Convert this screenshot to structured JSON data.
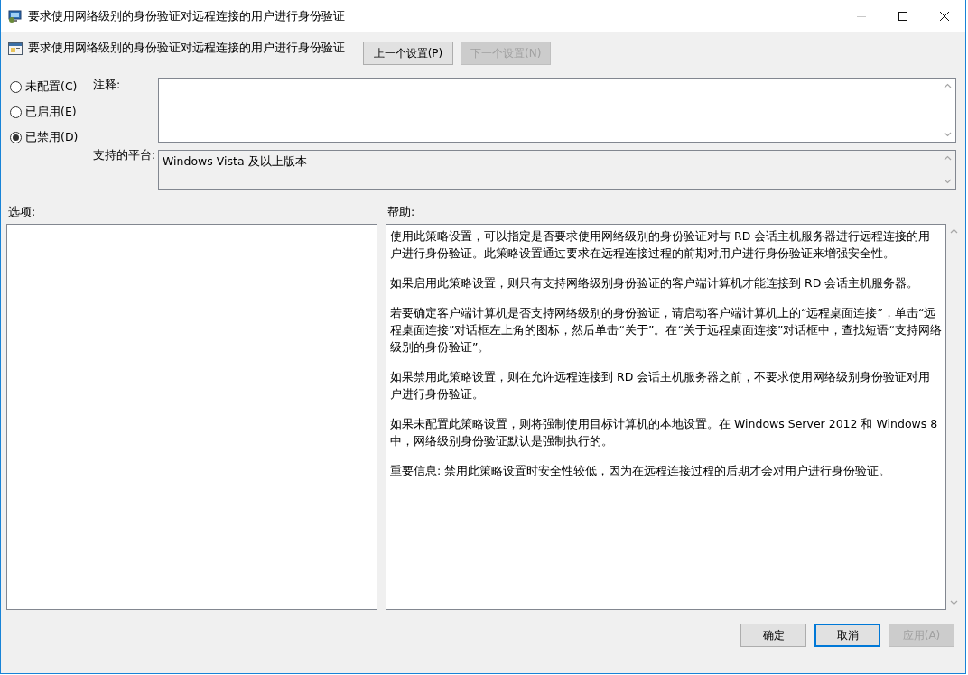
{
  "window": {
    "title": "要求使用网络级别的身份验证对远程连接的用户进行身份验证",
    "controls": [
      {
        "kind": "minimize",
        "disabled": true
      },
      {
        "kind": "maximize",
        "disabled": false
      },
      {
        "kind": "close",
        "disabled": false
      }
    ]
  },
  "header": {
    "title": "要求使用网络级别的身份验证对远程连接的用户进行身份验证",
    "buttons": [
      {
        "label": "上一个设置(P)",
        "disabled": false
      },
      {
        "label": "下一个设置(N)",
        "disabled": true
      }
    ]
  },
  "state_options": [
    {
      "label": "未配置(C)",
      "selected": false
    },
    {
      "label": "已启用(E)",
      "selected": false
    },
    {
      "label": "已禁用(D)",
      "selected": true
    }
  ],
  "comment": {
    "label": "注释:"
  },
  "platform": {
    "label": "支持的平台:",
    "value": "Windows Vista 及以上版本"
  },
  "options": {
    "label": "选项:"
  },
  "help": {
    "label": "帮助:",
    "paragraphs": [
      "使用此策略设置，可以指定是否要求使用网络级别的身份验证对与 RD 会话主机服务器进行远程连接的用户进行身份验证。此策略设置通过要求在远程连接过程的前期对用户进行身份验证来增强安全性。",
      "如果启用此策略设置，则只有支持网络级别身份验证的客户端计算机才能连接到 RD 会话主机服务器。",
      "若要确定客户端计算机是否支持网络级别的身份验证，请启动客户端计算机上的“远程桌面连接”，单击“远程桌面连接”对话框左上角的图标，然后单击“关于”。在“关于远程桌面连接”对话框中，查找短语“支持网络级别的身份验证”。",
      "如果禁用此策略设置，则在允许远程连接到 RD 会话主机服务器之前，不要求使用网络级别身份验证对用户进行身份验证。",
      "如果未配置此策略设置，则将强制使用目标计算机的本地设置。在 Windows Server 2012 和 Windows 8 中，网络级别身份验证默认是强制执行的。",
      "重要信息: 禁用此策略设置时安全性较低，因为在远程连接过程的后期才会对用户进行身份验证。"
    ]
  },
  "footer_buttons": [
    {
      "label": "确定",
      "default": false,
      "disabled": false
    },
    {
      "label": "取消",
      "default": true,
      "disabled": false
    },
    {
      "label": "应用(A)",
      "default": false,
      "disabled": true
    }
  ]
}
